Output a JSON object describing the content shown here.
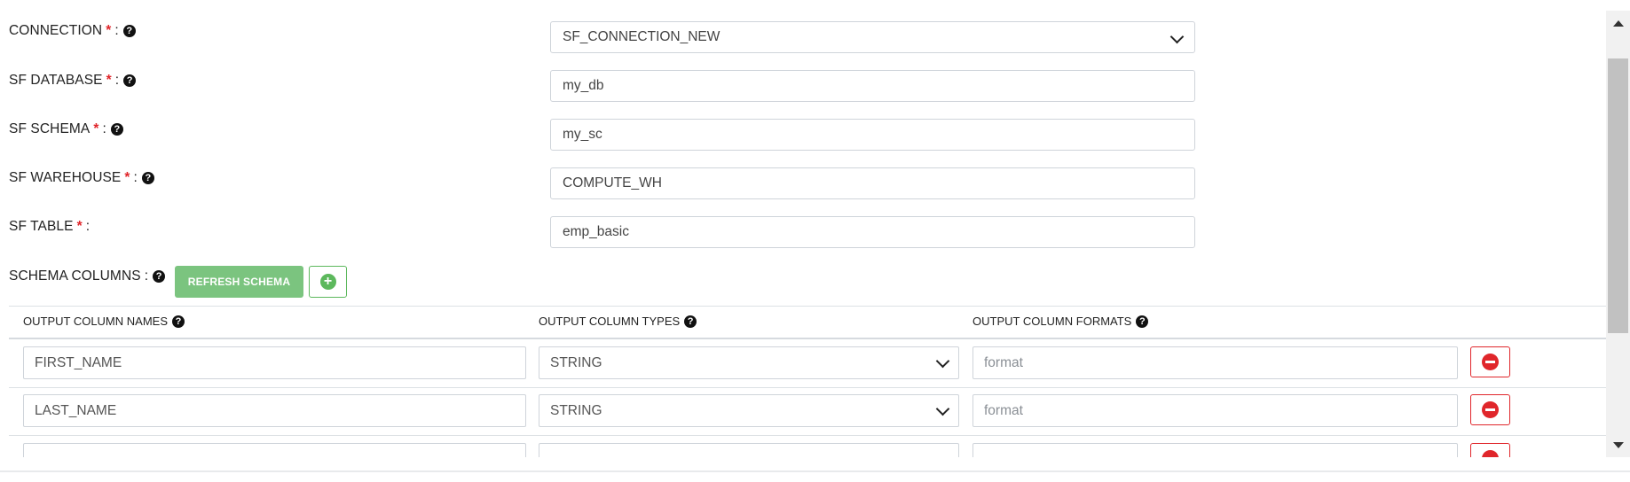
{
  "form": {
    "connection": {
      "label": "CONNECTION",
      "value": "SF_CONNECTION_NEW"
    },
    "database": {
      "label": "SF DATABASE",
      "value": "my_db"
    },
    "schema": {
      "label": "SF SCHEMA",
      "value": "my_sc"
    },
    "warehouse": {
      "label": "SF WAREHOUSE",
      "value": "COMPUTE_WH"
    },
    "table": {
      "label": "SF TABLE",
      "value": "emp_basic"
    },
    "required_mark": "*",
    "separator": ":",
    "help_glyph": "?"
  },
  "schema_columns": {
    "label": "SCHEMA COLUMNS",
    "refresh_label": "REFRESH SCHEMA",
    "add_glyph": "+"
  },
  "table": {
    "headers": {
      "names": "OUTPUT COLUMN NAMES",
      "types": "OUTPUT COLUMN TYPES",
      "formats": "OUTPUT COLUMN FORMATS"
    },
    "rows": [
      {
        "name": "FIRST_NAME",
        "type": "STRING",
        "format_placeholder": "format"
      },
      {
        "name": "LAST_NAME",
        "type": "STRING",
        "format_placeholder": "format"
      }
    ]
  },
  "colors": {
    "required": "#e0262b",
    "refresh_button": "#7bc47f",
    "add_button": "#5cb85c",
    "remove_button": "#e0262b"
  },
  "icons": [
    "question-circle-icon",
    "plus-circle-icon",
    "minus-circle-icon",
    "chevron-down-icon",
    "scroll-up-arrow-icon",
    "scroll-down-arrow-icon"
  ]
}
